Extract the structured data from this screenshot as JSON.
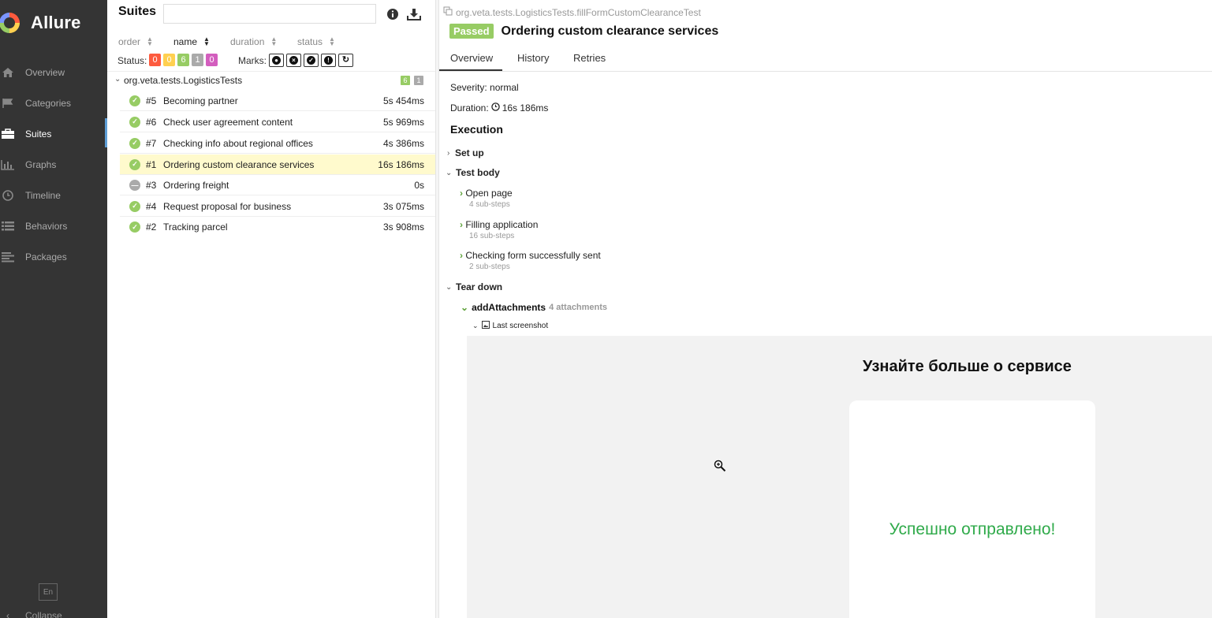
{
  "sidebar": {
    "brand": "Allure",
    "items": [
      {
        "label": "Overview",
        "icon": "home-icon"
      },
      {
        "label": "Categories",
        "icon": "flag-icon"
      },
      {
        "label": "Suites",
        "icon": "briefcase-icon"
      },
      {
        "label": "Graphs",
        "icon": "bar-chart-icon"
      },
      {
        "label": "Timeline",
        "icon": "clock-icon"
      },
      {
        "label": "Behaviors",
        "icon": "list-icon"
      },
      {
        "label": "Packages",
        "icon": "align-left-icon"
      }
    ],
    "active_item": "Suites",
    "language": "En",
    "collapse_label": "Collapse"
  },
  "suites": {
    "title": "Suites",
    "search_value": "",
    "sort": {
      "order": "order",
      "name": "name",
      "duration": "duration",
      "status": "status"
    },
    "status_label": "Status:",
    "status_counts": [
      {
        "value": "0",
        "color": "#fd5a3e"
      },
      {
        "value": "0",
        "color": "#ffd050"
      },
      {
        "value": "6",
        "color": "#97cc64"
      },
      {
        "value": "1",
        "color": "#aaaaaa"
      },
      {
        "value": "0",
        "color": "#d35ebe"
      }
    ],
    "marks_label": "Marks:",
    "marks": [
      "bomb-icon",
      "times-circle-icon",
      "check-circle-icon",
      "exclamation-circle-icon",
      "refresh-icon"
    ],
    "group": {
      "name": "org.veta.tests.LogisticsTests",
      "passed": "6",
      "skipped": "1"
    },
    "tests": [
      {
        "num": "#5",
        "name": "Becoming partner",
        "duration": "5s 454ms",
        "status": "passed"
      },
      {
        "num": "#6",
        "name": "Check user agreement content",
        "duration": "5s 969ms",
        "status": "passed"
      },
      {
        "num": "#7",
        "name": "Checking info about regional offices",
        "duration": "4s 386ms",
        "status": "passed"
      },
      {
        "num": "#1",
        "name": "Ordering custom clearance services",
        "duration": "16s 186ms",
        "status": "passed",
        "selected": true
      },
      {
        "num": "#3",
        "name": "Ordering freight",
        "duration": "0s",
        "status": "skipped"
      },
      {
        "num": "#4",
        "name": "Request proposal for business",
        "duration": "3s 075ms",
        "status": "passed"
      },
      {
        "num": "#2",
        "name": "Tracking parcel",
        "duration": "3s 908ms",
        "status": "passed"
      }
    ]
  },
  "detail": {
    "fullname": "org.veta.tests.LogisticsTests.fillFormCustomClearanceTest",
    "status": "Passed",
    "title": "Ordering custom clearance services",
    "tabs": [
      "Overview",
      "History",
      "Retries"
    ],
    "severity": "Severity: normal",
    "duration_label": "Duration:",
    "duration_value": "16s 186ms",
    "execution_heading": "Execution",
    "setup": "Set up",
    "test_body": "Test body",
    "steps": [
      {
        "name": "Open page",
        "sub": "4 sub-steps"
      },
      {
        "name": "Filling application",
        "sub": "16 sub-steps"
      },
      {
        "name": "Checking form successfully sent",
        "sub": "2 sub-steps"
      }
    ],
    "teardown": "Tear down",
    "attachment_step": "addAttachments",
    "attachment_count": "4 attachments",
    "attachment_item": "Last screenshot",
    "preview": {
      "heading": "Узнайте больше о сервисе",
      "success": "Успешно отправлено!"
    }
  }
}
